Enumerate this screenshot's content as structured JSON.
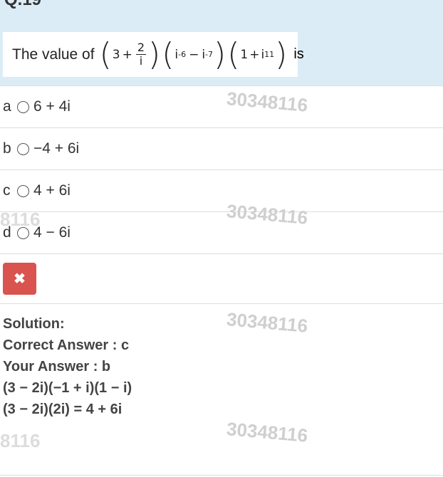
{
  "question": {
    "number": "Q.19",
    "prefix": "The value of",
    "math": {
      "a": "3",
      "plus": "+",
      "frac_num": "2",
      "frac_den": "i",
      "i1": "i",
      "e1": "-6",
      "minus": "−",
      "i2": "i",
      "e2": "-7",
      "one": "1",
      "plus2": "+",
      "i3": "i",
      "e3": "11"
    },
    "suffix": "is"
  },
  "options": [
    {
      "letter": "a",
      "text": "6 + 4i"
    },
    {
      "letter": "b",
      "text": "−4 + 6i"
    },
    {
      "letter": "c",
      "text": "4 + 6i"
    },
    {
      "letter": "d",
      "text": "4 − 6i"
    }
  ],
  "result_icon": "close-icon",
  "result_symbol": "✖",
  "solution": {
    "heading": "Solution:",
    "correct": "Correct Answer : c",
    "yours": "Your Answer : b",
    "line1": "(3 − 2i)(−1 + i)(1 − i)",
    "line2": "(3 − 2i)(2i) = 4 + 6i"
  },
  "watermarks": {
    "full": "30348116",
    "fragment": "8116"
  },
  "colors": {
    "header_bg": "#dcecf6",
    "wrong_button": "#d9534f"
  }
}
